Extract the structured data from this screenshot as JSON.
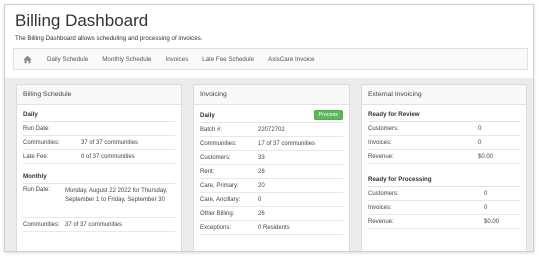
{
  "page": {
    "title": "Billing Dashboard",
    "description": "The Billing Dashboard allows scheduling and processing of invoices."
  },
  "nav": {
    "home_icon": "home-icon",
    "tabs": [
      {
        "label": "Daily Schedule"
      },
      {
        "label": "Monthly Schedule"
      },
      {
        "label": "Invoices"
      },
      {
        "label": "Late Fee Schedule"
      },
      {
        "label": "AxisCare Invoice"
      }
    ]
  },
  "billing_schedule": {
    "title": "Billing Schedule",
    "daily": {
      "title": "Daily",
      "run_date_label": "Run Date:",
      "run_date_value": "",
      "communities_label": "Communities:",
      "communities_value": "37 of 37 communities",
      "late_fee_label": "Late Fee:",
      "late_fee_value": "0 of 37 communities"
    },
    "monthly": {
      "title": "Monthly",
      "run_date_label": "Run Date:",
      "run_date_value": "Monday, August 22 2022 for Thursday, September 1 to Friday, September 30",
      "communities_label": "Communities:",
      "communities_value": "37 of 37 communities"
    }
  },
  "invoicing": {
    "title": "Invoicing",
    "daily_title": "Daily",
    "process_label": "Process",
    "rows": [
      {
        "label": "Batch #:",
        "value": "22072702"
      },
      {
        "label": "Communities:",
        "value": "17 of 37 communities"
      },
      {
        "label": "Customers:",
        "value": "33"
      },
      {
        "label": "Rent:",
        "value": "28"
      },
      {
        "label": "Care, Primary:",
        "value": "20"
      },
      {
        "label": "Care, Ancillary:",
        "value": "0"
      },
      {
        "label": "Other Billing:",
        "value": "26"
      },
      {
        "label": "Exceptions:",
        "value": "0 Residents"
      }
    ]
  },
  "external_invoicing": {
    "title": "External Invoicing",
    "review": {
      "title": "Ready for Review",
      "rows": [
        {
          "label": "Customers:",
          "value": "0"
        },
        {
          "label": "Invoices:",
          "value": "0"
        },
        {
          "label": "Revenue:",
          "value": "$0.00"
        }
      ]
    },
    "processing": {
      "title": "Ready for Processing",
      "rows": [
        {
          "label": "Customers:",
          "value": "0"
        },
        {
          "label": "Invoices:",
          "value": "0"
        },
        {
          "label": "Revenue:",
          "value": "$0.00"
        }
      ]
    }
  },
  "colors": {
    "process_button": "#5cb85c",
    "content_background": "#ececec"
  }
}
